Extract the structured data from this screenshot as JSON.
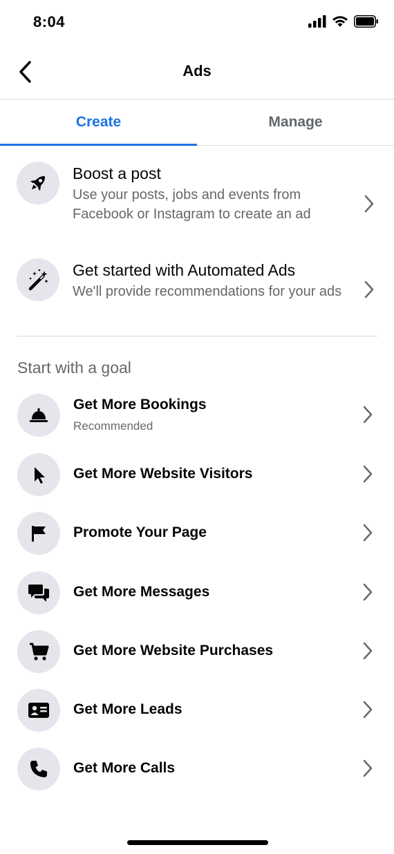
{
  "status_bar": {
    "time": "8:04"
  },
  "nav": {
    "title": "Ads"
  },
  "tabs": [
    {
      "label": "Create",
      "active": true
    },
    {
      "label": "Manage",
      "active": false
    }
  ],
  "options": [
    {
      "title": "Boost a post",
      "description": "Use your posts, jobs and events from Facebook or Instagram to create an ad",
      "icon": "rocket-icon"
    },
    {
      "title": "Get started with Automated Ads",
      "description": "We'll provide recommendations for your ads",
      "icon": "magic-wand-icon"
    }
  ],
  "goals_section": {
    "title": "Start with a goal",
    "items": [
      {
        "title": "Get More Bookings",
        "subtitle": "Recommended",
        "icon": "service-bell-icon"
      },
      {
        "title": "Get More Website Visitors",
        "icon": "cursor-icon"
      },
      {
        "title": "Promote Your Page",
        "icon": "flag-icon"
      },
      {
        "title": "Get More Messages",
        "icon": "chat-bubbles-icon"
      },
      {
        "title": "Get More Website Purchases",
        "icon": "shopping-cart-icon"
      },
      {
        "title": "Get More Leads",
        "icon": "contact-card-icon"
      },
      {
        "title": "Get More Calls",
        "icon": "phone-icon"
      }
    ]
  },
  "colors": {
    "accent": "#1b74e4",
    "icon_background": "#e4e6eb",
    "secondary_text": "#65676b"
  }
}
